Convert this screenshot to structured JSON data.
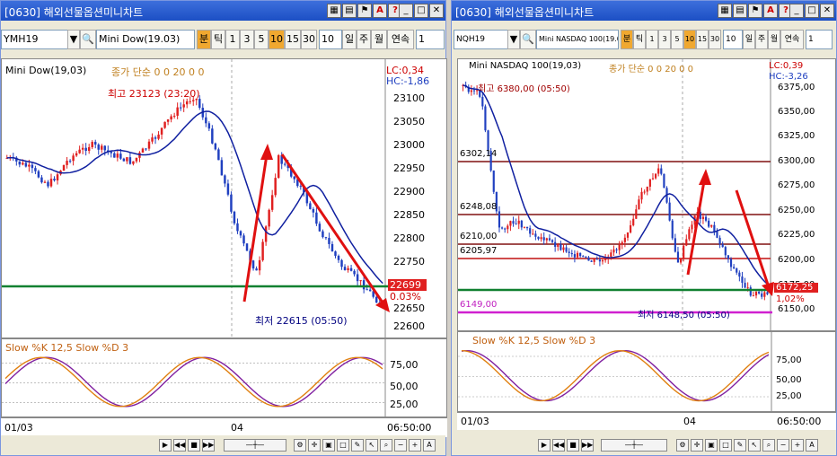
{
  "windows": [
    {
      "id": "w1",
      "title": "[0630] 해외선물옵션미니차트",
      "symbol": "YMH19",
      "name": "Mini Dow(19.03)",
      "period_buttons": [
        "분",
        "틱",
        "1",
        "3",
        "5",
        "10",
        "15",
        "30"
      ],
      "period_value": "10",
      "unit_buttons": [
        "일",
        "주",
        "월",
        "연속"
      ],
      "count_value": "1",
      "chart_title": "Mini Dow(19,03)",
      "indicator": "종가 단순 0 0 20 0 0",
      "lc": "LC:0,34",
      "hc": "HC:-1,86",
      "high_label": "최고 23123 (23:20)",
      "low_label": "최저 22615 (05:50)",
      "price_axis": [
        "23100",
        "23050",
        "23000",
        "22950",
        "22900",
        "22850",
        "22800",
        "22750",
        "22700",
        "22650",
        "22600"
      ],
      "current_price": "22699",
      "change_pct": "0.03%",
      "date_start": "01/03",
      "date_mid": "04",
      "time": "06:50:00",
      "osc_title": "Slow %K 12,5  Slow %D 3",
      "osc_axis": [
        "75,00",
        "50,00",
        "25,00"
      ]
    },
    {
      "id": "w2",
      "title": "[0630] 해외선물옵션미니차트",
      "symbol": "NQH19",
      "name": "Mini NASDAQ 100(19.03)",
      "period_buttons": [
        "분",
        "틱",
        "1",
        "3",
        "5",
        "10",
        "15",
        "30"
      ],
      "period_value": "10",
      "unit_buttons": [
        "일",
        "주",
        "월",
        "연속"
      ],
      "count_value": "1",
      "chart_title": "Mini NASDAQ 100(19,03)",
      "indicator": "종가 단순 0 0 20 0 0",
      "lc": "LC:0,39",
      "hc": "HC:-3,26",
      "high_label": "최고 6380,00 (05:50)",
      "low_label": "최저 6148,50 (05:50)",
      "price_axis": [
        "6375,00",
        "6350,00",
        "6325,00",
        "6300,00",
        "6275,00",
        "6250,00",
        "6225,00",
        "6200,00",
        "6175,00",
        "6150,00"
      ],
      "level_labels": [
        "6302,14",
        "6248,08",
        "6210,00",
        "6205,97",
        "6149,00"
      ],
      "current_price": "6172,25",
      "change_pct": "1,02%",
      "date_start": "01/03",
      "date_mid": "04",
      "time": "06:50:00",
      "osc_title": "Slow %K 12,5  Slow %D 3",
      "osc_axis": [
        "75,00",
        "50,00",
        "25,00"
      ]
    }
  ],
  "colors": {
    "up": "#e02020",
    "down": "#2040c0",
    "ma": "#1020a0",
    "green_line": "#108030",
    "magenta_line": "#d020d0",
    "brown_line": "#801010",
    "k": "#e08010",
    "d": "#8020a0"
  }
}
